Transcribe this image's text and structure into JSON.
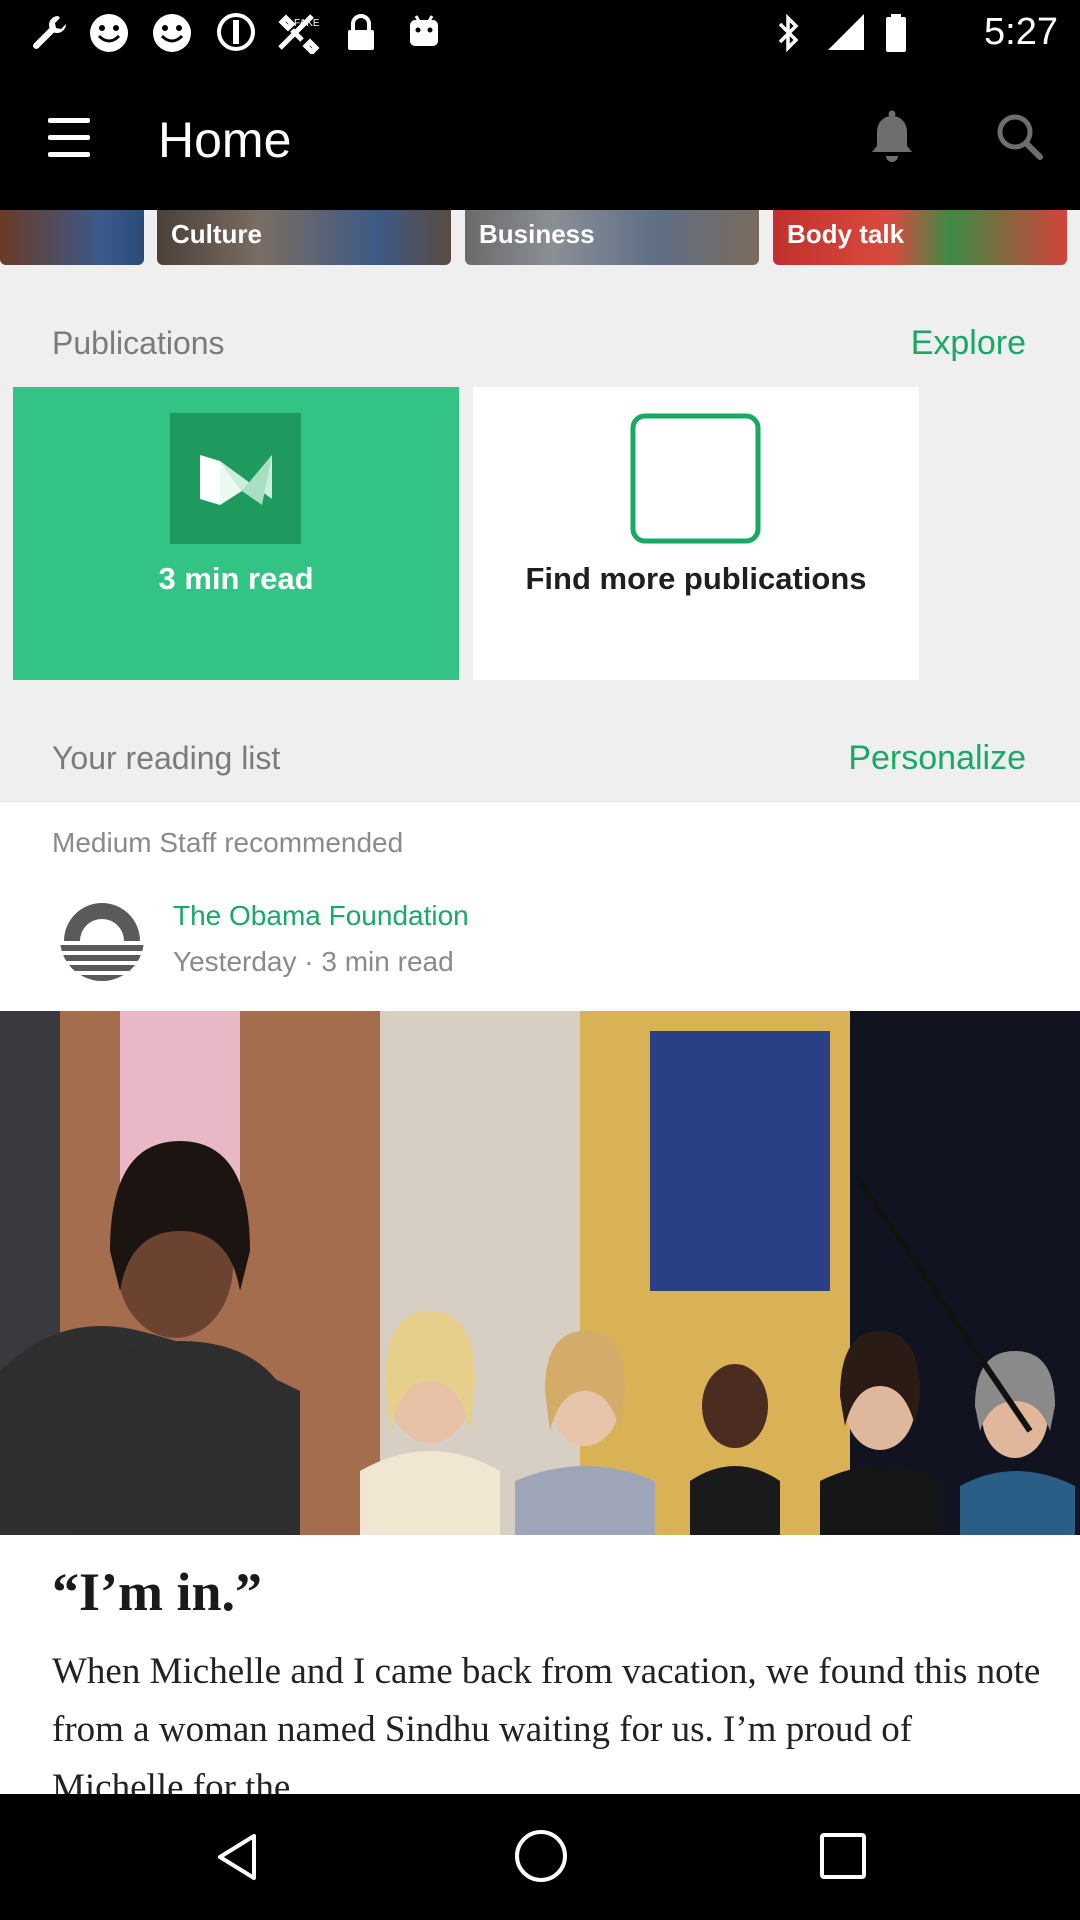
{
  "status_bar": {
    "time": "5:27",
    "left_icons": [
      "wrench-icon",
      "smiley-icon",
      "smiley-icon",
      "do-not-disturb-icon",
      "fake-gps-icon",
      "lock-icon",
      "android-icon"
    ],
    "right_icons": [
      "bluetooth-icon",
      "signal-icon",
      "battery-icon"
    ]
  },
  "app_bar": {
    "title": "Home",
    "menu_icon": "menu-icon",
    "bell_icon": "bell-icon",
    "search_icon": "search-icon"
  },
  "topics": [
    {
      "label": ""
    },
    {
      "label": "Culture"
    },
    {
      "label": "Business"
    },
    {
      "label": "Body talk"
    }
  ],
  "publications": {
    "title": "Publications",
    "action": "Explore",
    "cards": [
      {
        "label": "3 min read",
        "icon": "medium-logo-icon"
      },
      {
        "label": "Find more publications",
        "icon": "empty-box-icon"
      }
    ]
  },
  "reading_list": {
    "title": "Your reading list",
    "action": "Personalize"
  },
  "post": {
    "recommended_by": "Medium Staff recommended",
    "author": "The Obama Foundation",
    "meta": "Yesterday · 3 min read",
    "avatar_icon": "obama-foundation-logo-icon",
    "title": "“I’m in.”",
    "body": "When Michelle and I came back from vacation, we found this note from a woman named Sindhu waiting for us. I’m proud of Michelle for the…"
  },
  "nav_bar": {
    "back_icon": "back-icon",
    "home_icon": "home-icon",
    "recents_icon": "recents-icon"
  },
  "colors": {
    "accent_green": "#17a966",
    "card_green": "#33c384",
    "bar_black": "#000000",
    "background": "#efefef"
  }
}
